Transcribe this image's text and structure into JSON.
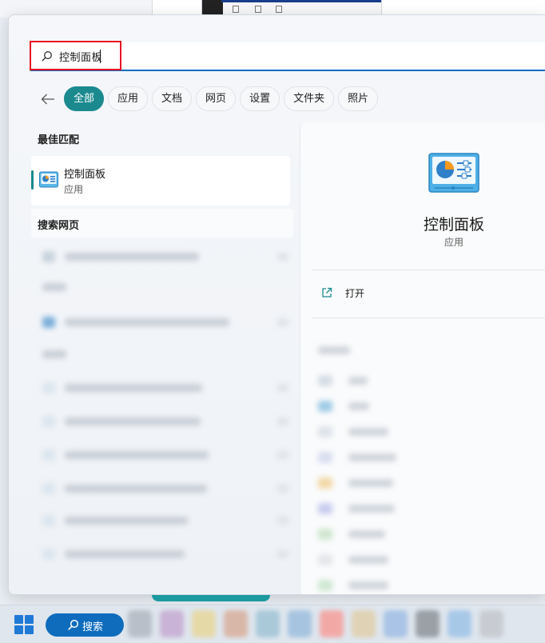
{
  "search": {
    "query": "控制面板"
  },
  "filters": [
    {
      "label": "全部",
      "active": true
    },
    {
      "label": "应用",
      "active": false
    },
    {
      "label": "文档",
      "active": false
    },
    {
      "label": "网页",
      "active": false
    },
    {
      "label": "设置",
      "active": false
    },
    {
      "label": "文件夹",
      "active": false
    },
    {
      "label": "照片",
      "active": false
    }
  ],
  "best_match": {
    "section_title": "最佳匹配",
    "name": "控制面板",
    "type": "应用"
  },
  "web_section": {
    "title": "搜索网页"
  },
  "preview": {
    "title": "控制面板",
    "subtitle": "应用",
    "actions": [
      {
        "label": "打开",
        "icon": "open-external-icon"
      }
    ]
  },
  "taskbar": {
    "search_label": "搜索"
  },
  "colors": {
    "accent": "#1b8a8f",
    "highlight_box": "#e81123",
    "taskbar_search": "#0f6cbd",
    "windows_logo": "#1f7ad6"
  }
}
